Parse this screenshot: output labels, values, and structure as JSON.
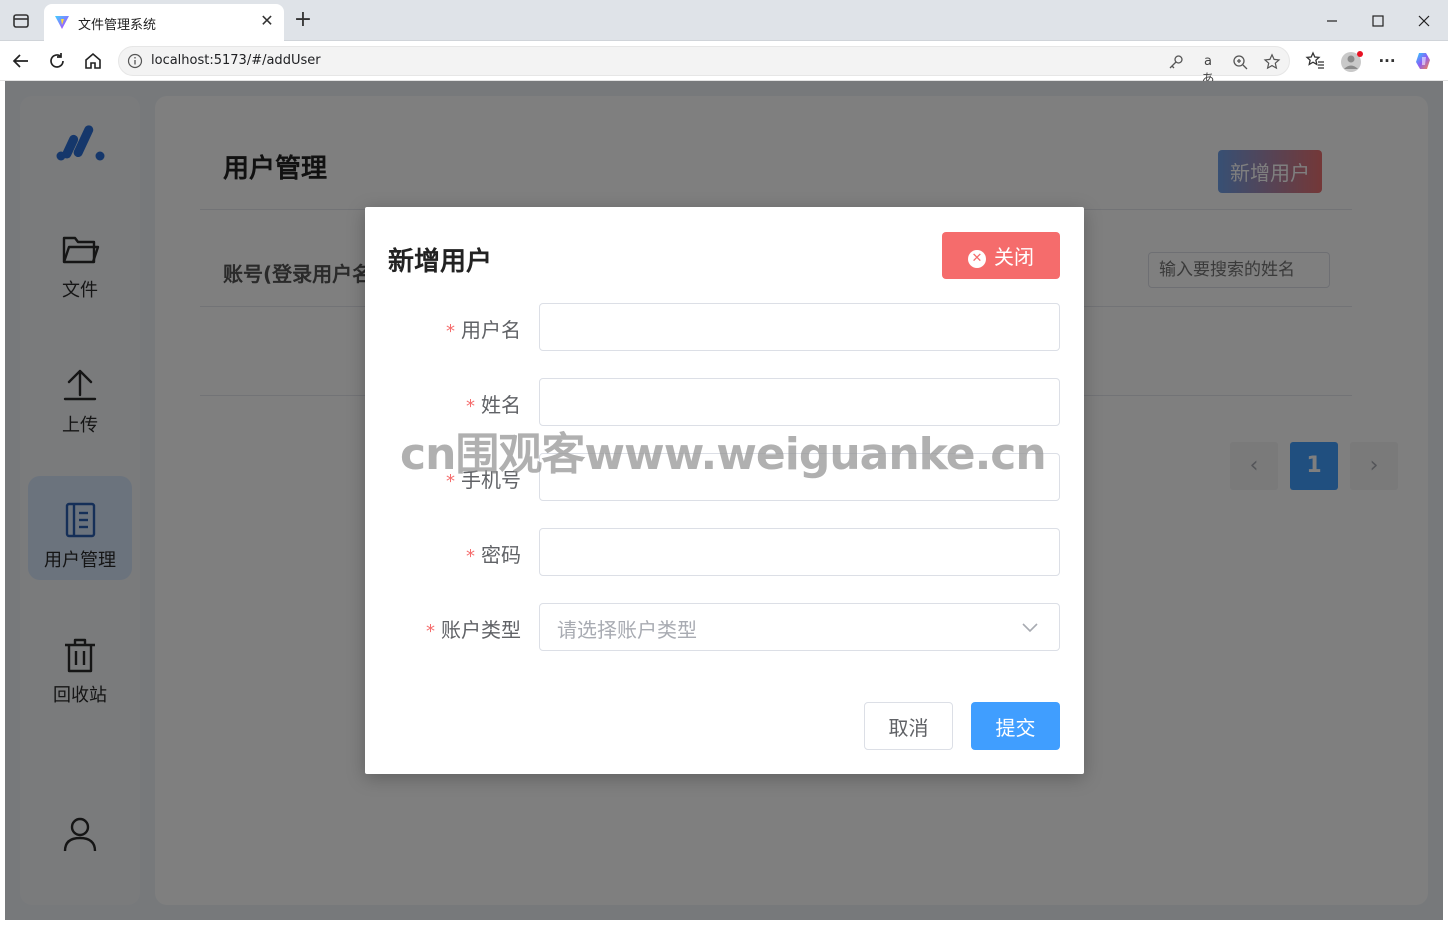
{
  "browser": {
    "tab_title": "文件管理系统",
    "tab_close": "✕",
    "new_tab": "+",
    "url": "localhost:5173/#/addUser",
    "icons": [
      "tab-actions-icon",
      "vite-favicon-icon",
      "back-icon",
      "reload-icon",
      "home-icon",
      "info-icon",
      "key-icon",
      "read-aloud-icon",
      "zoom-icon",
      "star-icon",
      "favorites-icon",
      "profile-icon",
      "more-icon",
      "copilot-icon",
      "minimize-icon",
      "maximize-icon",
      "close-window-icon"
    ],
    "read_aloud_label": "aあ",
    "more_label": "···"
  },
  "sidebar": {
    "items": [
      {
        "label": "文件",
        "icon": "folder-icon"
      },
      {
        "label": "上传",
        "icon": "upload-icon"
      },
      {
        "label": "用户管理",
        "icon": "notebook-icon",
        "active": true
      },
      {
        "label": "回收站",
        "icon": "trash-icon"
      }
    ],
    "avatar_icon": "user-icon"
  },
  "main": {
    "title": "用户管理",
    "add_button": "新增用户",
    "column_header": "账号(登录用户名)",
    "search_placeholder": "输入要搜索的姓名",
    "pagination": {
      "prev": "‹",
      "current": "1",
      "next": "›"
    }
  },
  "dialog": {
    "title": "新增用户",
    "close_button": "关闭",
    "fields": [
      {
        "label": "用户名",
        "required": true,
        "value": ""
      },
      {
        "label": "姓名",
        "required": true,
        "value": ""
      },
      {
        "label": "手机号",
        "required": true,
        "value": ""
      },
      {
        "label": "密码",
        "required": true,
        "value": ""
      },
      {
        "label": "账户类型",
        "required": true,
        "placeholder": "请选择账户类型"
      }
    ],
    "required_mark": "*",
    "cancel_button": "取消",
    "submit_button": "提交"
  },
  "watermark": "cn围观客www.weiguanke.cn",
  "colors": {
    "primary": "#409eff",
    "danger": "#f56c6c",
    "active_nav": "#d6e6fb"
  }
}
